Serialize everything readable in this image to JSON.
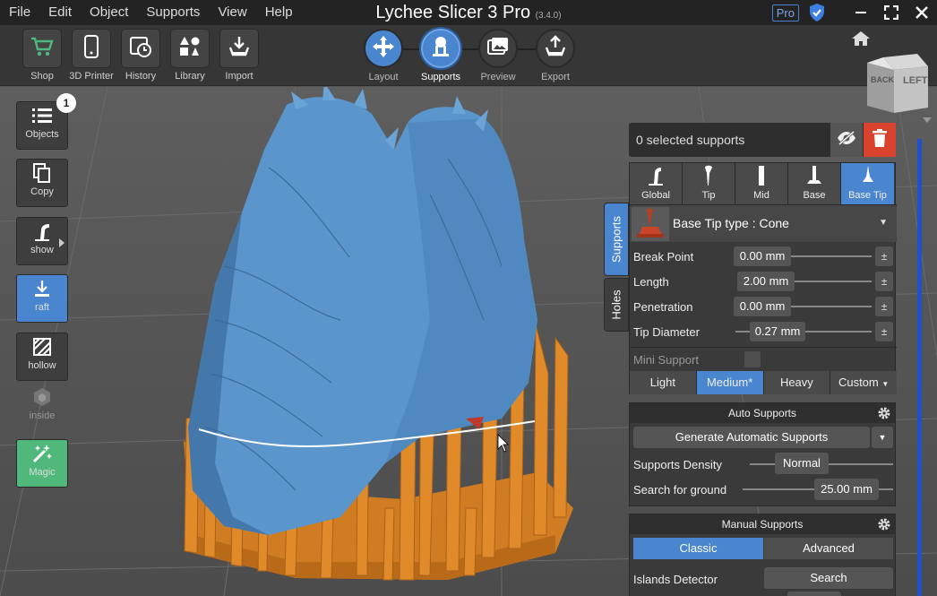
{
  "menu": [
    "File",
    "Edit",
    "Object",
    "Supports",
    "View",
    "Help"
  ],
  "app": {
    "title": "Lychee Slicer 3 Pro",
    "version": "(3.4.0)",
    "pro_badge": "Pro"
  },
  "toolbar": {
    "tools": [
      {
        "label": "Shop",
        "icon": "cart-icon",
        "color": "#4fb87a"
      },
      {
        "label": "3D Printer",
        "icon": "phone-icon",
        "color": "#ffffff"
      },
      {
        "label": "History",
        "icon": "history-icon",
        "color": "#ffffff"
      },
      {
        "label": "Library",
        "icon": "shapes-icon",
        "color": "#ffffff"
      },
      {
        "label": "Import",
        "icon": "import-icon",
        "color": "#ffffff"
      }
    ],
    "steps": [
      {
        "label": "Layout",
        "active": false
      },
      {
        "label": "Supports",
        "active": true
      },
      {
        "label": "Preview",
        "active": false
      },
      {
        "label": "Export",
        "active": false
      }
    ]
  },
  "sidebar": {
    "objects": {
      "label": "Objects",
      "badge": "1"
    },
    "copy": {
      "label": "Copy"
    },
    "show": {
      "label": "show"
    },
    "raft": {
      "label": "raft"
    },
    "hollow": {
      "label": "hollow"
    },
    "inside": {
      "label": "inside"
    },
    "magic": {
      "label": "Magic"
    }
  },
  "nav_cube": {
    "back": "BACK",
    "left": "LEFT"
  },
  "selection": {
    "text": "0 selected supports"
  },
  "side_tabs": {
    "supports": "Supports",
    "holes": "Holes"
  },
  "support_tabs": [
    "Global",
    "Tip",
    "Mid",
    "Base",
    "Base Tip"
  ],
  "tip_type": {
    "label": "Base Tip type : Cone"
  },
  "params": [
    {
      "name": "Break Point",
      "value": "0.00 mm",
      "fraction": 0.0
    },
    {
      "name": "Length",
      "value": "2.00 mm",
      "fraction": 0.05
    },
    {
      "name": "Penetration",
      "value": "0.00 mm",
      "fraction": 0.0
    },
    {
      "name": "Tip Diameter",
      "value": "0.27 mm",
      "fraction": 0.1
    }
  ],
  "plus_minus": "±",
  "mini_support": {
    "label": "Mini Support"
  },
  "weights": [
    "Light",
    "Medium*",
    "Heavy",
    "Custom"
  ],
  "auto_supports": {
    "title": "Auto Supports",
    "generate_label": "Generate Automatic Supports",
    "density_label": "Supports Density",
    "density_value": "Normal",
    "ground_label": "Search for ground",
    "ground_value": "25.00 mm"
  },
  "manual_supports": {
    "title": "Manual Supports",
    "modes": [
      "Classic",
      "Advanced"
    ],
    "islands_label": "Islands Detector",
    "islands_button": "Search"
  },
  "colors": {
    "accent": "#4a86d0",
    "danger": "#d9432e",
    "model": "#5a95cc",
    "supports": "#e08a2a",
    "magic": "#4fb87a"
  }
}
